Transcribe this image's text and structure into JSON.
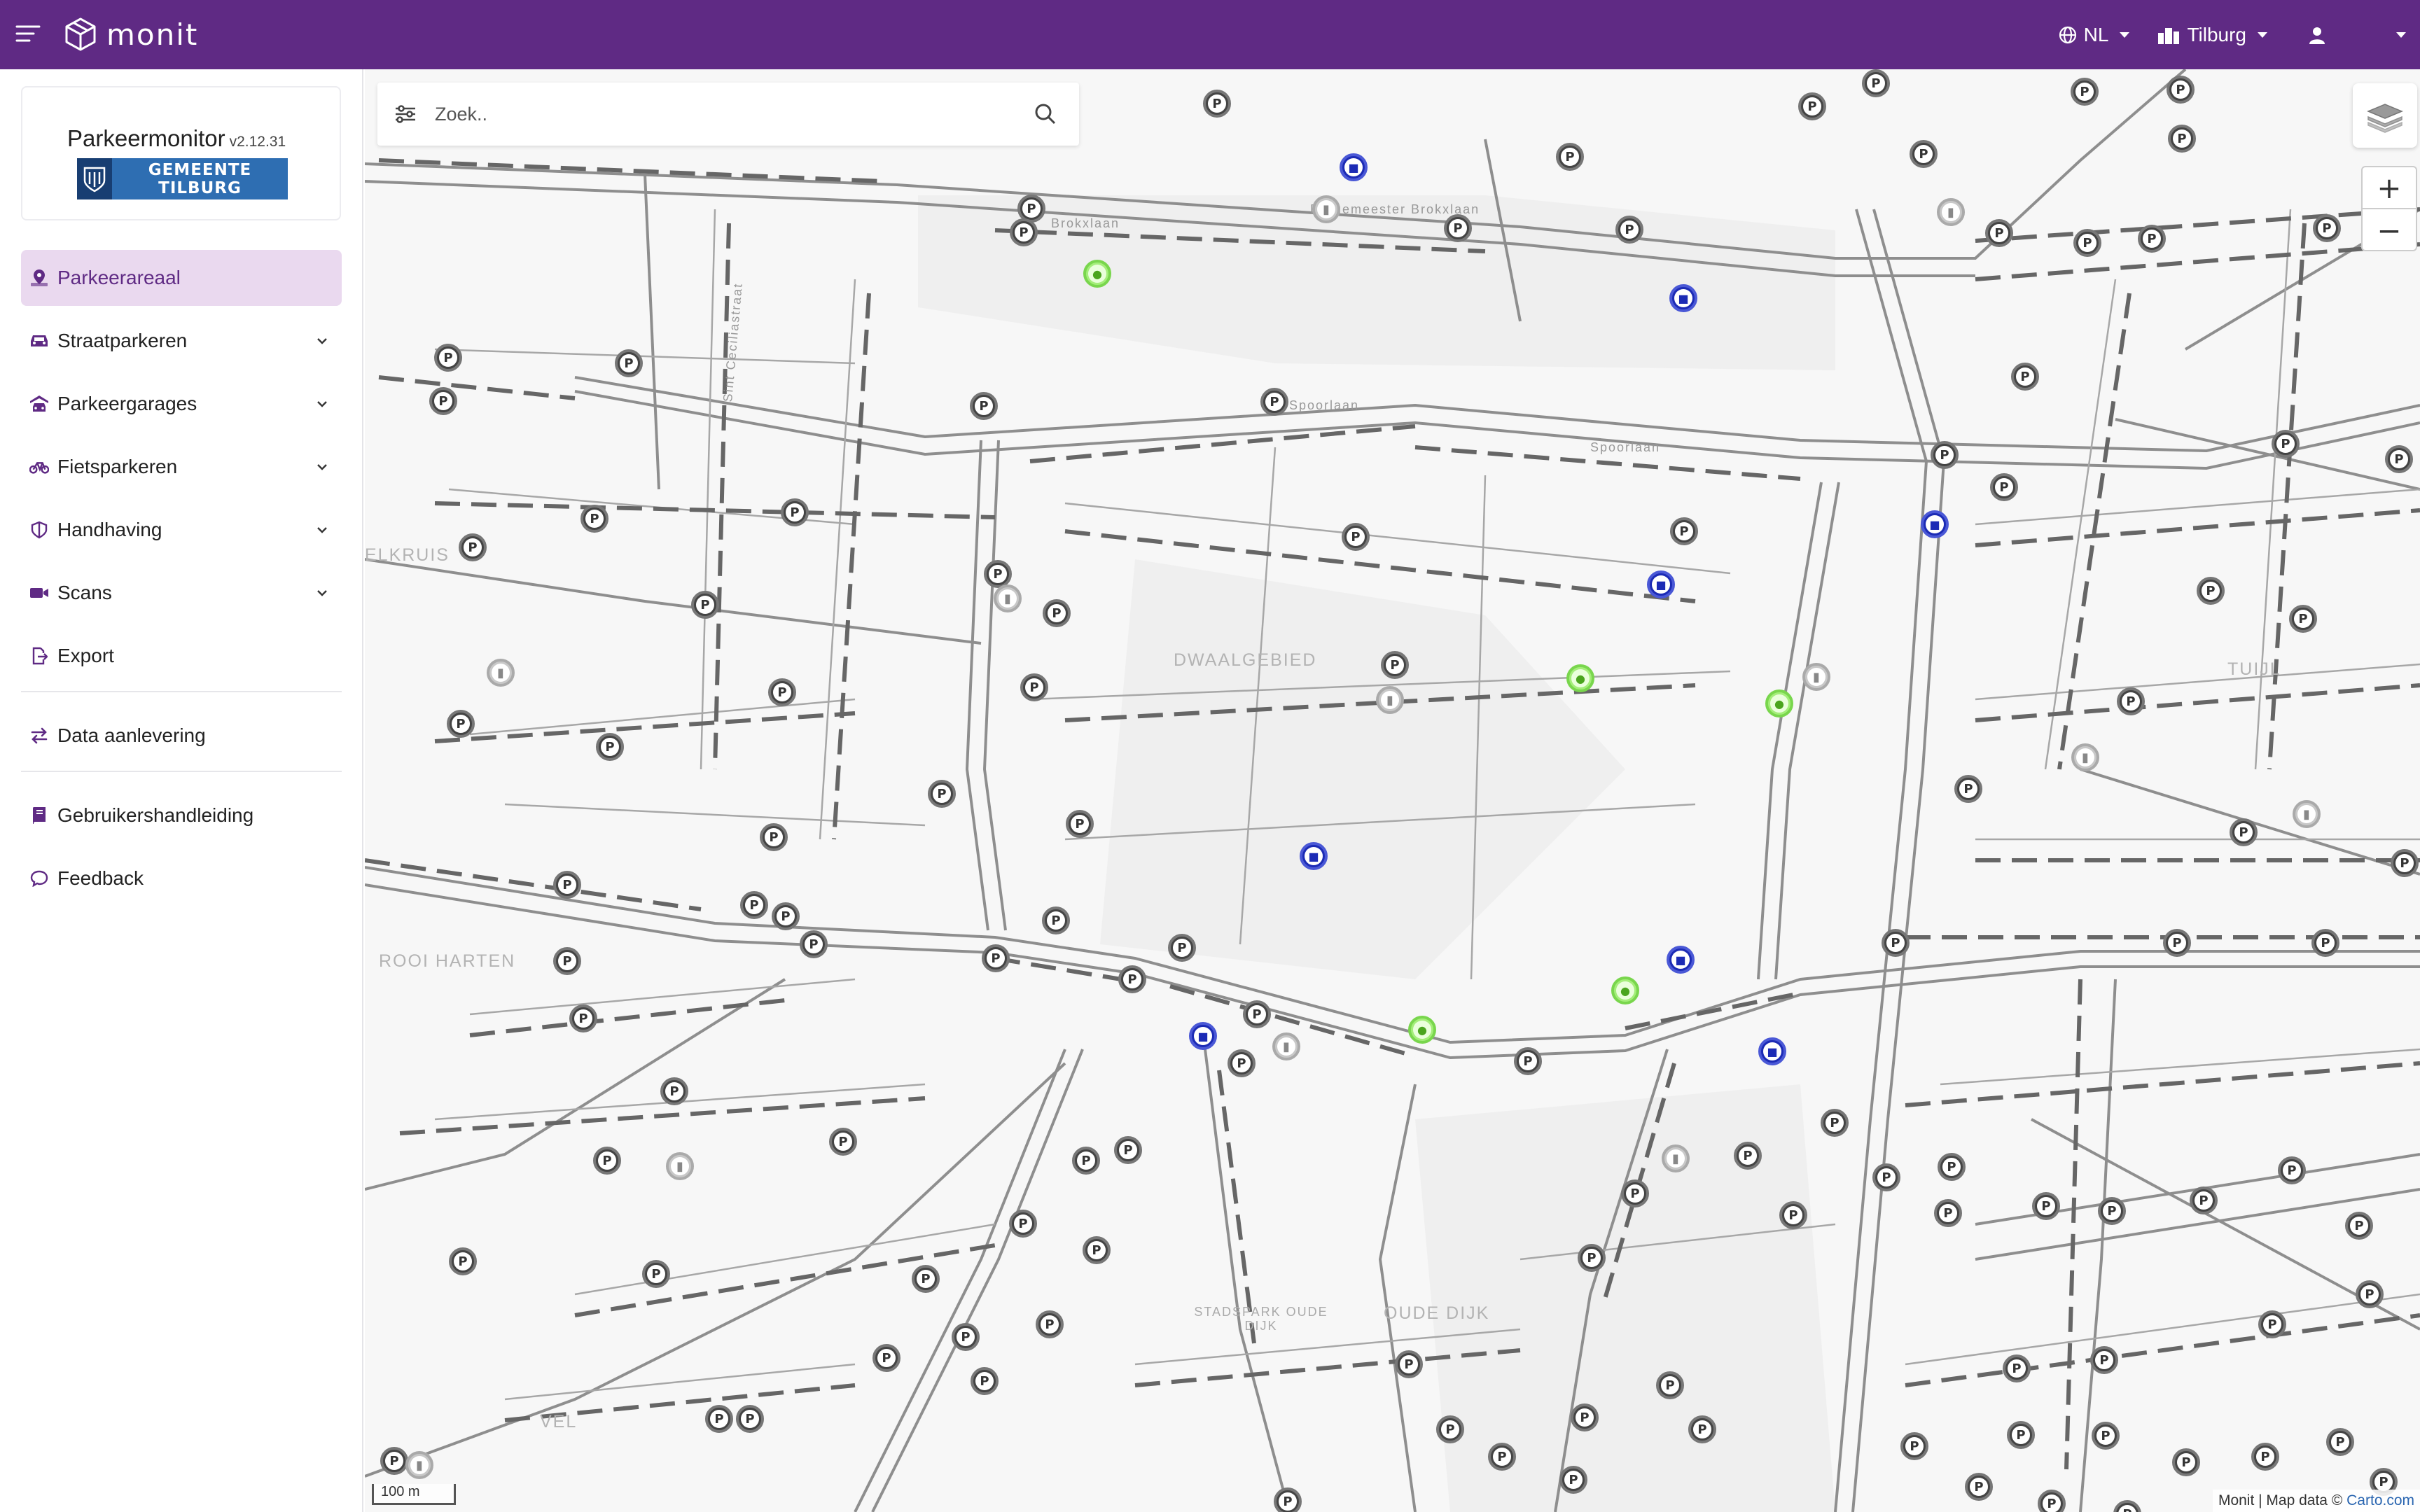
{
  "app": {
    "brand": "monit",
    "language": "NL",
    "city": "Tilburg"
  },
  "sidebar": {
    "product_title": "Parkeermonitor",
    "version": "v2.12.31",
    "municipality": "GEMEENTE TILBURG",
    "items": [
      {
        "label": "Parkeerareaal",
        "icon": "map-pin-icon",
        "active": true,
        "expandable": false
      },
      {
        "label": "Straatparkeren",
        "icon": "car-icon",
        "active": false,
        "expandable": true
      },
      {
        "label": "Parkeergarages",
        "icon": "garage-icon",
        "active": false,
        "expandable": true
      },
      {
        "label": "Fietsparkeren",
        "icon": "bike-icon",
        "active": false,
        "expandable": true
      },
      {
        "label": "Handhaving",
        "icon": "shield-icon",
        "active": false,
        "expandable": true
      },
      {
        "label": "Scans",
        "icon": "video-icon",
        "active": false,
        "expandable": true
      },
      {
        "label": "Export",
        "icon": "file-export-icon",
        "active": false,
        "expandable": false
      }
    ],
    "data_item": {
      "label": "Data aanlevering",
      "icon": "arrows-exchange-icon"
    },
    "help_items": [
      {
        "label": "Gebruikershandleiding",
        "icon": "book-icon"
      },
      {
        "label": "Feedback",
        "icon": "chat-icon"
      }
    ]
  },
  "search": {
    "placeholder": "Zoek.."
  },
  "map": {
    "districts": [
      "DWAALGEBIED",
      "ROOI HARTEN",
      "OUDE DIJK",
      "STADSPARK OUDE DIJK",
      "ELKRUIS",
      "TUIJL",
      "VEL"
    ],
    "streets": [
      "Spoorlaan",
      "Spoorlaan",
      "Burgemeester Brokxlaan",
      "Sint Ceciliastraat",
      "Brokxlaan"
    ],
    "scale_label": "100 m",
    "attribution_prefix": "Monit | Map data ©",
    "attribution_link": "Carto.com",
    "zoom_in": "+",
    "zoom_out": "−",
    "marker_colors": {
      "parking": "#444444",
      "garage": "#1c2bb5",
      "bike": "#a4ee7a",
      "meter": "#c8c8c8"
    }
  }
}
